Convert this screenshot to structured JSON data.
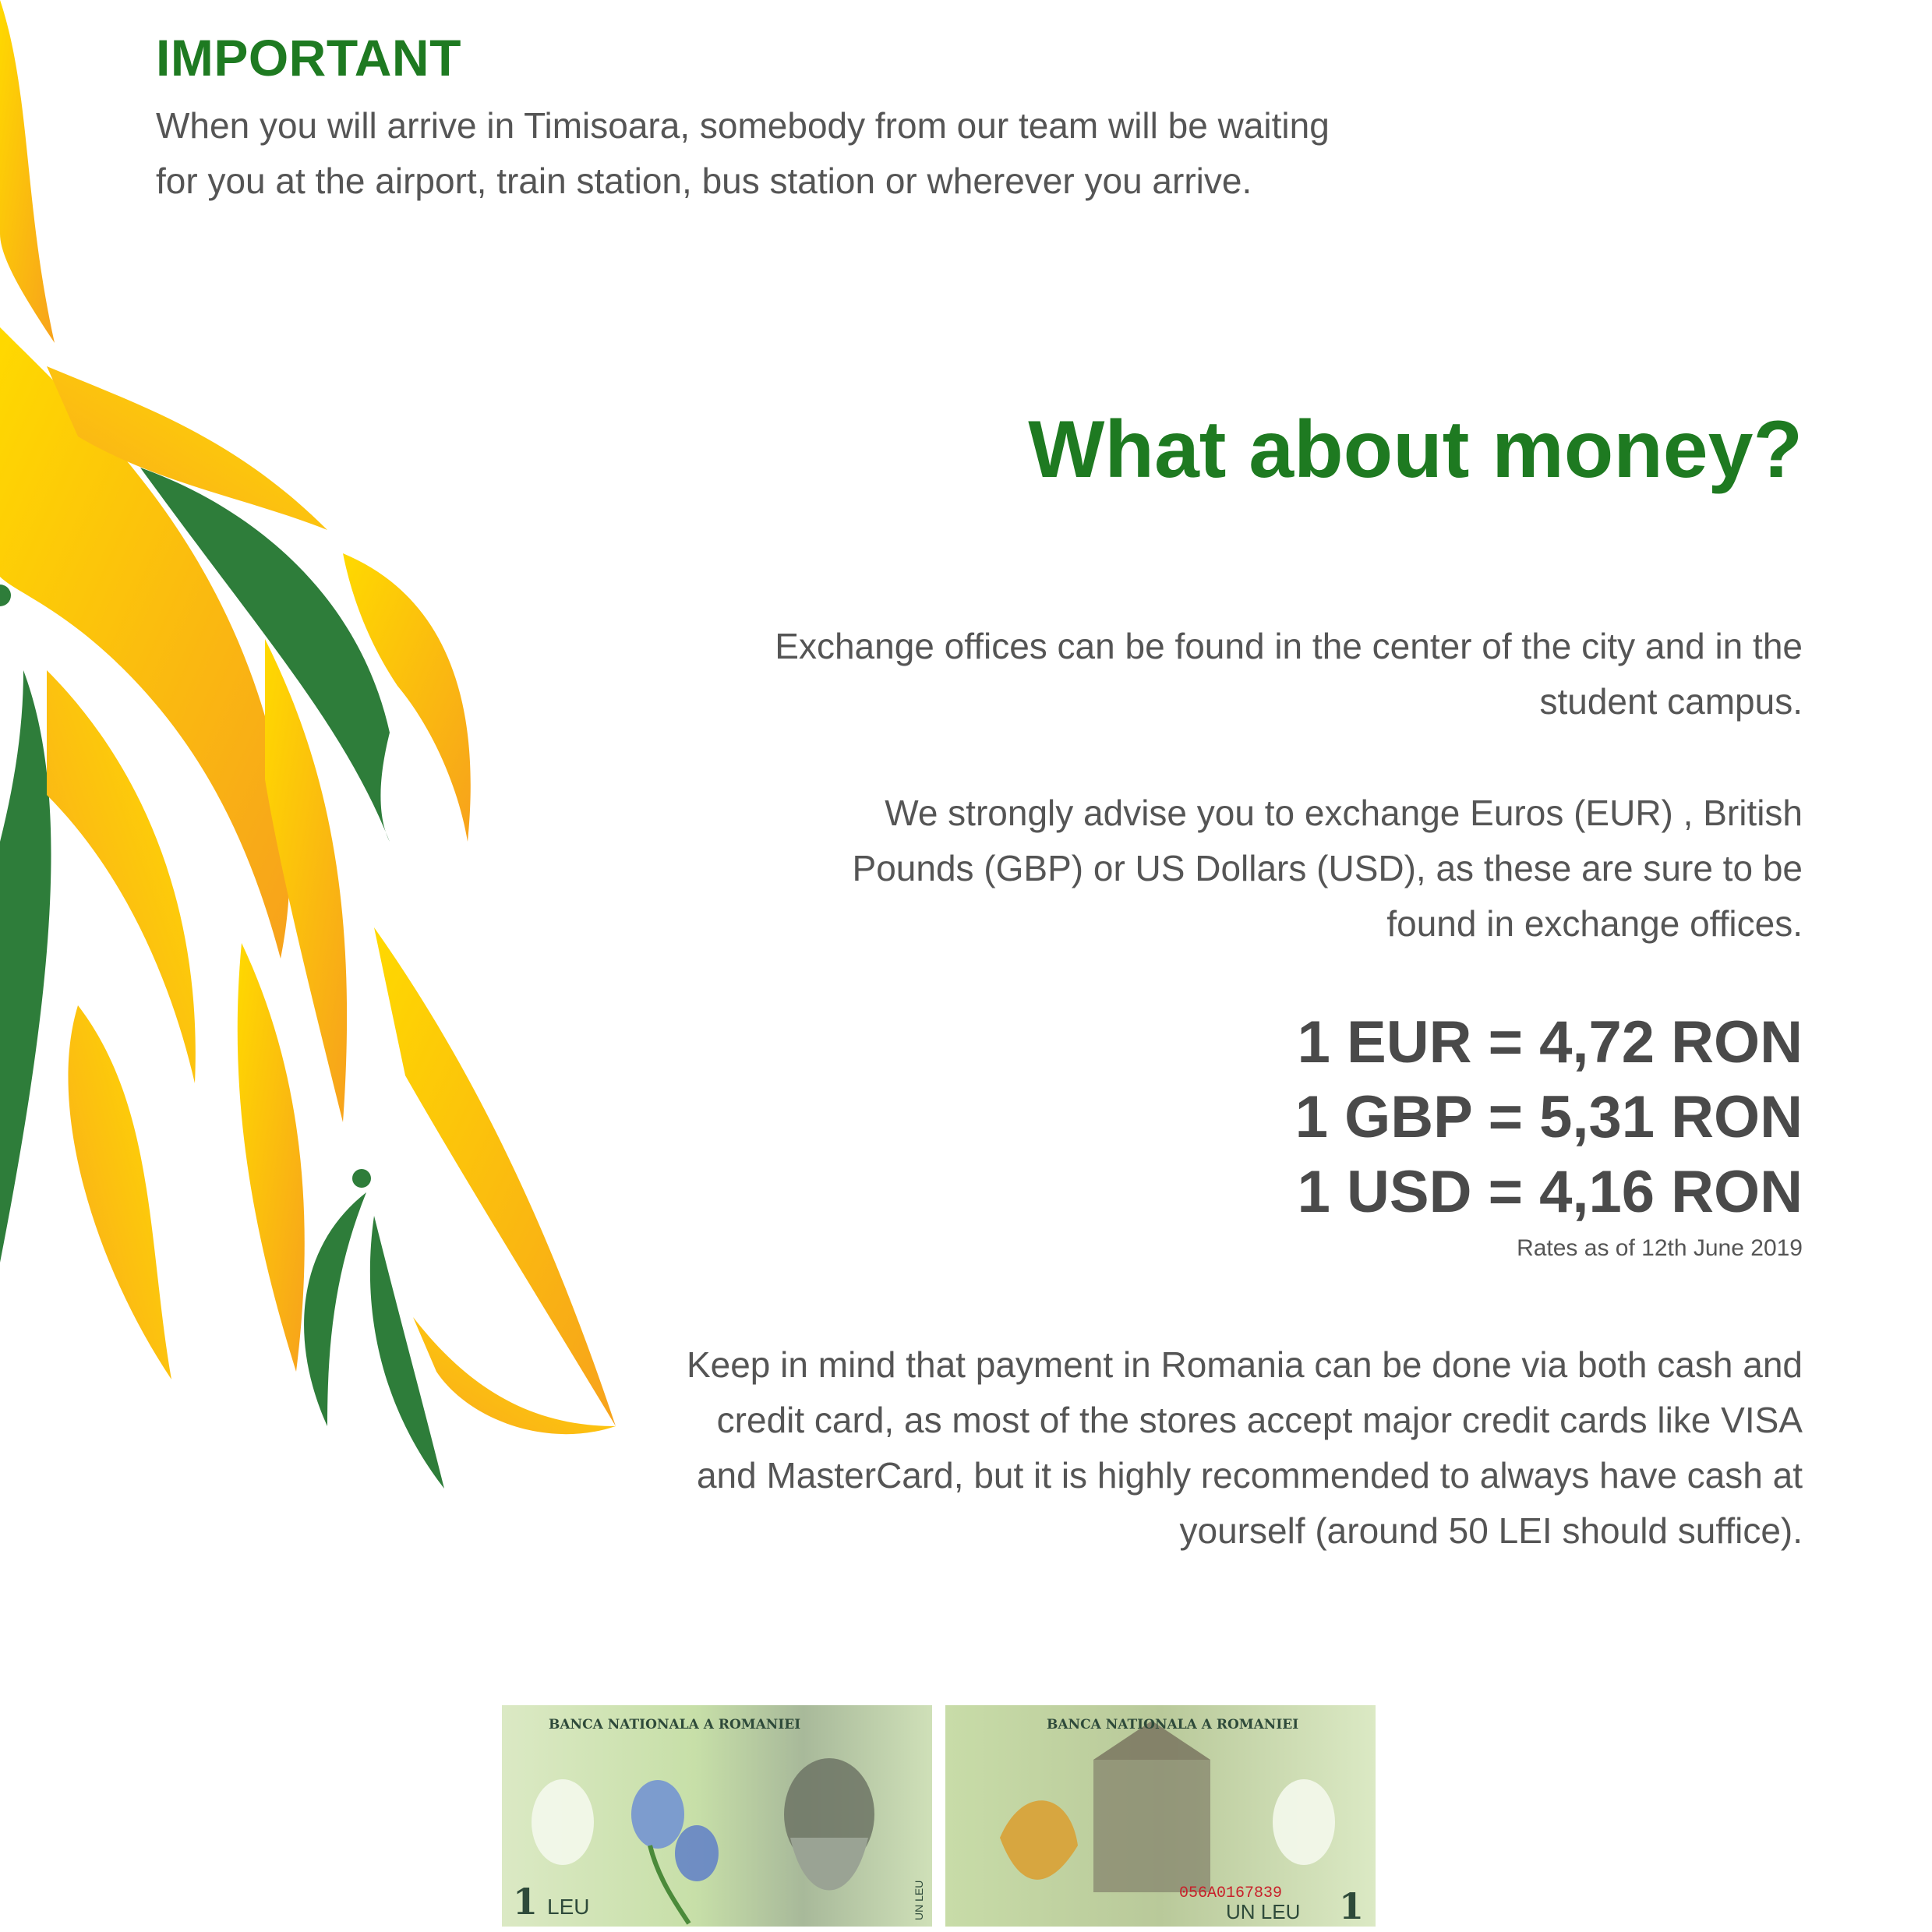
{
  "important": {
    "heading": "IMPORTANT",
    "text": "When you will arrive in Timisoara, somebody from our team will be waiting for you at the airport, train station, bus station or wherever you arrive."
  },
  "money": {
    "heading": "What about money?",
    "offices_text": "Exchange offices can be found in the center of the city and in the student campus.",
    "advise_text": "We strongly advise you to exchange Euros (EUR) , British Pounds (GBP) or US Dollars (USD), as these are sure to be found in exchange offices.",
    "rates": [
      "1 EUR = 4,72 RON",
      "1 GBP = 5,31 RON",
      "1 USD = 4,16 RON"
    ],
    "rates_note": "Rates as of 12th June 2019",
    "payment_text": "Keep in mind that payment in Romania can be done via both cash and credit card, as most of the stores accept major credit cards like VISA and MasterCard, but it is highly recommended to always have cash at yourself (around 50 LEI should suffice)."
  },
  "banknotes": {
    "front": {
      "bank_name": "BANCA NATIONALA A ROMANIEI",
      "denomination": "1",
      "currency": "LEU",
      "side_text": "UN LEU"
    },
    "back": {
      "bank_name": "BANCA NATIONALA A ROMANIEI",
      "denomination": "1",
      "currency": "UN LEU",
      "serial": "056A0167839"
    }
  },
  "colors": {
    "brand_green": "#1e7a21",
    "text_gray": "#555555",
    "rate_gray": "#4a4a4a",
    "flame_yellow": "#ffd000",
    "flame_orange": "#f7a51e",
    "leaf_green": "#2e7d3a"
  }
}
